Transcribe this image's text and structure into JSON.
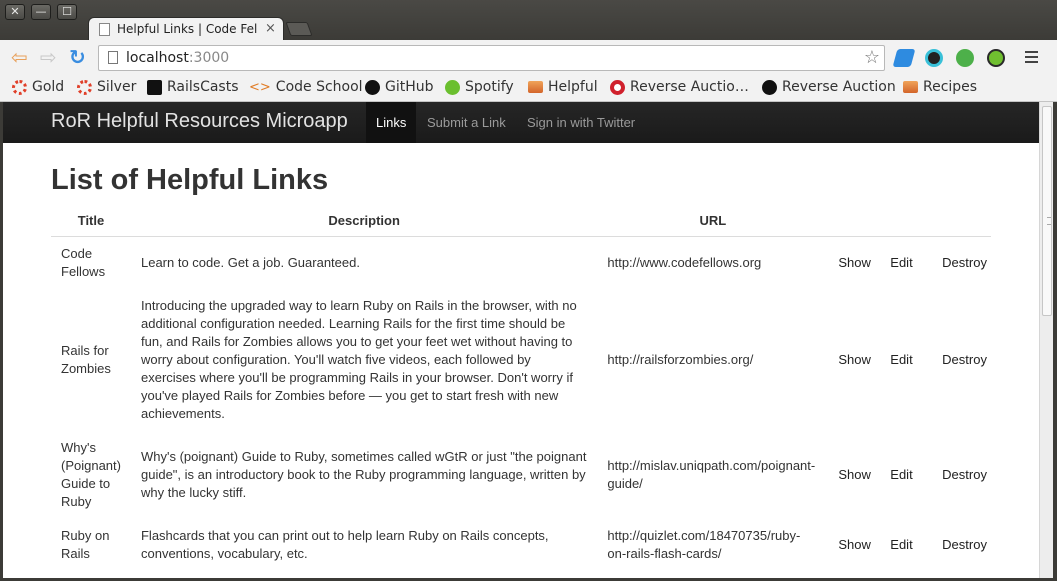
{
  "window": {
    "controls": {
      "close": "✕",
      "minimize": "—",
      "maximize": "☐"
    }
  },
  "tab": {
    "title": "Helpful Links | Code Fellows",
    "close": "×"
  },
  "toolbar": {
    "back": "⇦",
    "forward": "⇨",
    "reload": "↻",
    "url_host": "localhost",
    "url_port": ":3000",
    "bookmark_star": "☆"
  },
  "bookmarks": [
    {
      "label": "Gold",
      "icon": "gold-icon"
    },
    {
      "label": "Silver",
      "icon": "silver-icon"
    },
    {
      "label": "RailsCasts",
      "icon": "railscasts-icon"
    },
    {
      "label": "Code School",
      "icon": "code-school-icon"
    },
    {
      "label": "GitHub",
      "icon": "github-icon"
    },
    {
      "label": "Spotify",
      "icon": "spotify-icon"
    },
    {
      "label": "Helpful",
      "icon": "folder-icon"
    },
    {
      "label": "Reverse Auctio…",
      "icon": "reverse-auction-icon"
    },
    {
      "label": "Reverse Auction",
      "icon": "github-icon"
    },
    {
      "label": "Recipes",
      "icon": "folder-icon"
    }
  ],
  "navbar": {
    "brand": "RoR Helpful Resources Microapp",
    "links": [
      "Links",
      "Submit a Link",
      "Sign in with Twitter"
    ],
    "active": "Links"
  },
  "page": {
    "heading": "List of Helpful Links",
    "columns": [
      "Title",
      "Description",
      "URL"
    ],
    "actions": [
      "Show",
      "Edit",
      "Destroy"
    ],
    "rows": [
      {
        "title": "Code Fellows",
        "description": "Learn to code. Get a job. Guaranteed.",
        "url": "http://www.codefellows.org"
      },
      {
        "title": "Rails for Zombies",
        "description": "Introducing the upgraded way to learn Ruby on Rails in the browser, with no additional configuration needed. Learning Rails for the first time should be fun, and Rails for Zombies allows you to get your feet wet without having to worry about configuration. You'll watch five videos, each followed by exercises where you'll be programming Rails in your browser. Don't worry if you've played Rails for Zombies before — you get to start fresh with new achievements.",
        "url": "http://railsforzombies.org/"
      },
      {
        "title": "Why's (Poignant) Guide to Ruby",
        "description": "Why's (poignant) Guide to Ruby, sometimes called wGtR or just \"the poignant guide\", is an introductory book to the Ruby programming language, written by why the lucky stiff.",
        "url": "http://mislav.uniqpath.com/poignant-guide/"
      },
      {
        "title": "Ruby on Rails",
        "description": "Flashcards that you can print out to help learn Ruby on Rails concepts, conventions, vocabulary, etc.",
        "url": "http://quizlet.com/18470735/ruby-on-rails-flash-cards/"
      }
    ]
  }
}
